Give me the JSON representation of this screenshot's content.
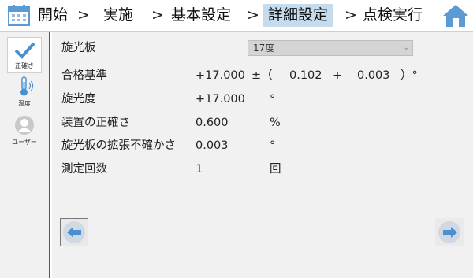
{
  "breadcrumb": {
    "items": [
      "開始",
      "実施",
      "基本設定",
      "詳細設定",
      "点検実行"
    ],
    "separator": ">",
    "active_index": 3
  },
  "sidebar": {
    "items": [
      {
        "label": "正確さ",
        "icon": "checkmark-icon",
        "selected": true
      },
      {
        "label": "温度",
        "icon": "thermometer-icon",
        "selected": false
      },
      {
        "label": "ユーザー",
        "icon": "user-icon",
        "selected": false
      }
    ]
  },
  "form": {
    "polarizer_label": "旋光板",
    "polarizer_value": "17度",
    "acceptance_label": "合格基準",
    "acceptance_value": "+17.000",
    "acceptance_pm": "±（",
    "acceptance_v1": "0.102",
    "acceptance_plus": "+",
    "acceptance_v2": "0.003",
    "acceptance_close": "）°",
    "rotation_label": "旋光度",
    "rotation_value": "+17.000",
    "rotation_unit": "°",
    "accuracy_label": "装置の正確さ",
    "accuracy_value": "0.600",
    "accuracy_unit": "%",
    "uncertainty_label": "旋光板の拡張不確かさ",
    "uncertainty_value": "0.003",
    "uncertainty_unit": "°",
    "count_label": "測定回数",
    "count_value": "1",
    "count_unit": "回"
  },
  "colors": {
    "active_crumb": "#c5dcef",
    "icon_blue": "#4a8fd0",
    "home_blue": "#5b9bd5"
  }
}
